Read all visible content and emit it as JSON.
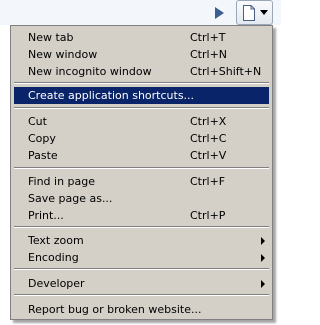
{
  "toolbar": {
    "icons": [
      "play-arrow-icon",
      "page-menu-icon",
      "chevron-down-icon"
    ]
  },
  "menu": {
    "items": [
      {
        "label": "New tab",
        "shortcut": "Ctrl+T"
      },
      {
        "label": "New window",
        "shortcut": "Ctrl+N"
      },
      {
        "label": "New incognito window",
        "shortcut": "Ctrl+Shift+N"
      },
      {
        "label": "Create application shortcuts...",
        "shortcut": ""
      },
      {
        "label": "Cut",
        "shortcut": "Ctrl+X"
      },
      {
        "label": "Copy",
        "shortcut": "Ctrl+C"
      },
      {
        "label": "Paste",
        "shortcut": "Ctrl+V"
      },
      {
        "label": "Find in page",
        "shortcut": "Ctrl+F"
      },
      {
        "label": "Save page as...",
        "shortcut": ""
      },
      {
        "label": "Print...",
        "shortcut": "Ctrl+P"
      },
      {
        "label": "Text zoom",
        "shortcut": ""
      },
      {
        "label": "Encoding",
        "shortcut": ""
      },
      {
        "label": "Developer",
        "shortcut": ""
      },
      {
        "label": "Report bug or broken website...",
        "shortcut": ""
      }
    ],
    "selected_label": "Create application shortcuts...",
    "colors": {
      "background": "#d4d0c8",
      "selected": "#0a246a"
    }
  }
}
